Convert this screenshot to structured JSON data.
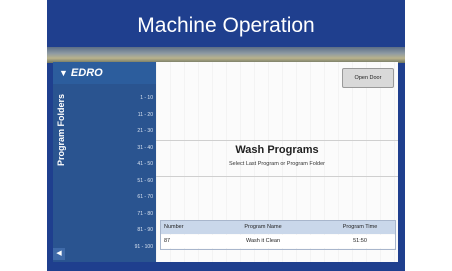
{
  "slide": {
    "title": "Machine Operation"
  },
  "app": {
    "brand": "EDRO",
    "folders_label": "Program Folders",
    "ranges": [
      "1 - 10",
      "11 - 20",
      "21 - 30",
      "31 - 40",
      "41 - 50",
      "51 - 60",
      "61 - 70",
      "71 - 80",
      "81 - 90",
      "91 - 100"
    ],
    "open_door_label": "Open Door",
    "wash_title": "Wash Programs",
    "wash_subtitle": "Select Last Program or Program Folder",
    "table": {
      "headers": [
        "Number",
        "Program Name",
        "Program Time"
      ],
      "rows": [
        [
          "87",
          "Wash it Clean",
          "51:50"
        ]
      ]
    }
  },
  "colors": {
    "slide_bg": "#1f3f8e",
    "sidebar": "#2a5490",
    "table_header": "#c9d7ea"
  }
}
